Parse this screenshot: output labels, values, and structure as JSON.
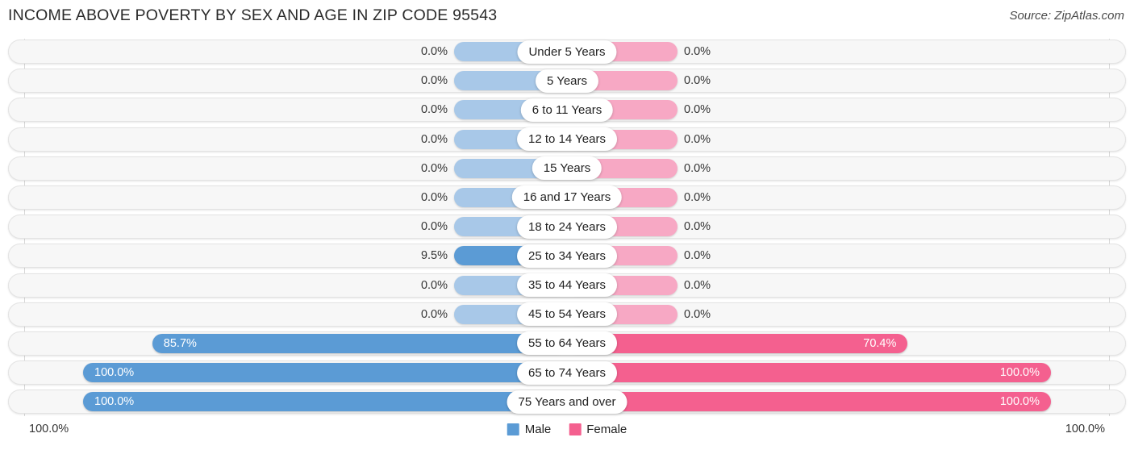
{
  "header": {
    "title": "INCOME ABOVE POVERTY BY SEX AND AGE IN ZIP CODE 95543",
    "source": "Source: ZipAtlas.com"
  },
  "footer": {
    "axis_min": "100.0%",
    "axis_max": "100.0%",
    "legend": [
      {
        "label": "Male",
        "color": "#5b9bd5"
      },
      {
        "label": "Female",
        "color": "#f4608f"
      }
    ]
  },
  "colors": {
    "male_strong": "#5b9bd5",
    "male_light": "#a8c8e8",
    "female_strong": "#f4608f",
    "female_light": "#f7a8c4",
    "track": "#f7f7f7"
  },
  "chart_data": {
    "type": "bar",
    "title": "INCOME ABOVE POVERTY BY SEX AND AGE IN ZIP CODE 95543",
    "subtitle": "",
    "xlabel": "",
    "ylabel": "",
    "orientation": "horizontal-diverging",
    "grid": true,
    "legend_position": "bottom-center",
    "xlim": [
      0,
      100
    ],
    "axis_tick_labels": [
      "100.0%",
      "100.0%"
    ],
    "categories": [
      "Under 5 Years",
      "5 Years",
      "6 to 11 Years",
      "12 to 14 Years",
      "15 Years",
      "16 and 17 Years",
      "18 to 24 Years",
      "25 to 34 Years",
      "35 to 44 Years",
      "45 to 54 Years",
      "55 to 64 Years",
      "65 to 74 Years",
      "75 Years and over"
    ],
    "series": [
      {
        "name": "Male",
        "color": "#5b9bd5",
        "values": [
          0.0,
          0.0,
          0.0,
          0.0,
          0.0,
          0.0,
          0.0,
          9.5,
          0.0,
          0.0,
          85.7,
          100.0,
          100.0
        ],
        "labels": [
          "0.0%",
          "0.0%",
          "0.0%",
          "0.0%",
          "0.0%",
          "0.0%",
          "0.0%",
          "9.5%",
          "0.0%",
          "0.0%",
          "85.7%",
          "100.0%",
          "100.0%"
        ]
      },
      {
        "name": "Female",
        "color": "#f4608f",
        "values": [
          0.0,
          0.0,
          0.0,
          0.0,
          0.0,
          0.0,
          0.0,
          0.0,
          0.0,
          0.0,
          70.4,
          100.0,
          100.0
        ],
        "labels": [
          "0.0%",
          "0.0%",
          "0.0%",
          "0.0%",
          "0.0%",
          "0.0%",
          "0.0%",
          "0.0%",
          "0.0%",
          "0.0%",
          "70.4%",
          "100.0%",
          "100.0%"
        ]
      }
    ]
  }
}
